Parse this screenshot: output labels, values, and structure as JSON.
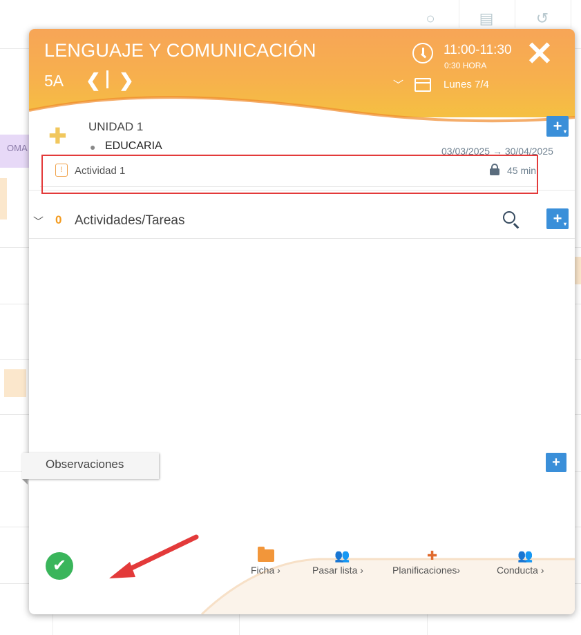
{
  "header": {
    "title": "LENGUAJE Y COMUNICACIÓN",
    "course": "5A",
    "prev_symbol": "❮",
    "next_symbol": "❯",
    "time": "11:00-11:30",
    "duration": "0:30 HORA",
    "close_symbol": "✕",
    "date": "Lunes 7/4"
  },
  "unit": {
    "title": "UNIDAD 1",
    "teacher": "EDUCARIA",
    "date_range": "03/03/2025 → 30/04/2025",
    "activity": {
      "label": "Actividad 1",
      "duration": "45 min"
    }
  },
  "tasks": {
    "count": "0",
    "label": "Actividades/Tareas"
  },
  "observations": {
    "label": "Observaciones"
  },
  "footer": {
    "items": [
      {
        "label": "Ficha ›"
      },
      {
        "label": "Pasar lista ›"
      },
      {
        "label": "Planificaciones›"
      },
      {
        "label": "Conducta ›"
      }
    ]
  },
  "background": {
    "tab_label": "OMA"
  },
  "colors": {
    "header_orange": "#f7a557",
    "header_yellow": "#f5c042",
    "accent_blue": "#3a8fd9",
    "task_count": "#f39b1f",
    "highlight_red": "#e33a3a",
    "check_green": "#3ab55b",
    "icon_orange": "#e06a2c"
  }
}
